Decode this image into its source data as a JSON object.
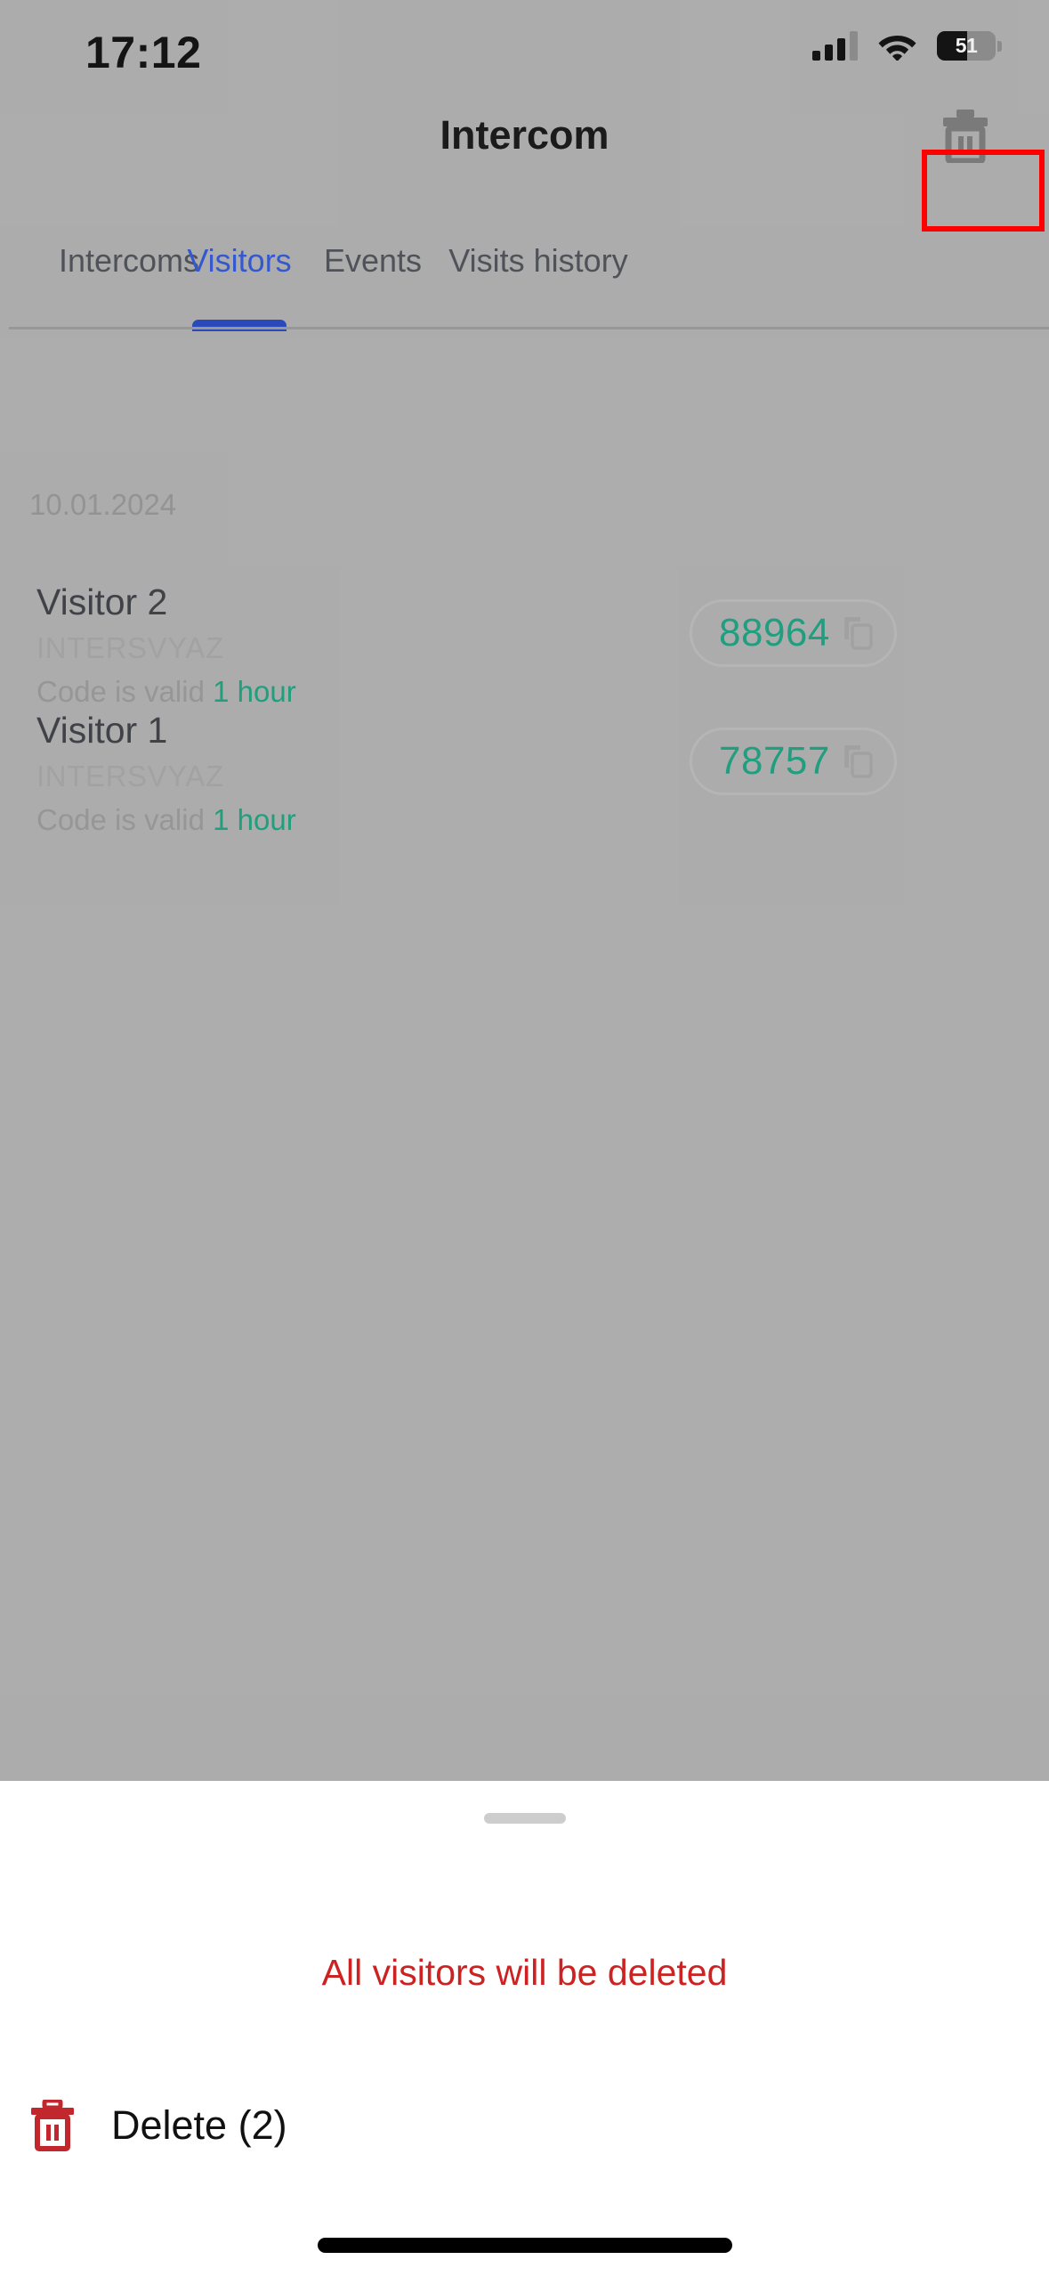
{
  "status_bar": {
    "time": "17:12",
    "battery_level": "51",
    "signal_icon": "cellular-signal-icon",
    "wifi_icon": "wifi-icon",
    "battery_icon": "battery-icon"
  },
  "header": {
    "title": "Intercom",
    "delete_all_icon": "trash-icon",
    "highlight_color": "#ff0000"
  },
  "tabs": {
    "active_color": "#2d55d8",
    "items": [
      {
        "label": "Intercoms",
        "active": false
      },
      {
        "label": "Visitors",
        "active": true
      },
      {
        "label": "Events",
        "active": false
      },
      {
        "label": "Visits history",
        "active": false
      }
    ]
  },
  "list": {
    "date_header": "10.01.2024",
    "code_color": "#18a382",
    "visitors": [
      {
        "name": "Visitor 2",
        "org": "INTERSVYAZ",
        "validity_prefix": "Code is valid ",
        "validity_value": "1 hour",
        "code": "88964",
        "copy_icon": "copy-icon"
      },
      {
        "name": "Visitor 1",
        "org": "INTERSVYAZ",
        "validity_prefix": "Code is valid ",
        "validity_value": "1 hour",
        "code": "78757",
        "copy_icon": "copy-icon"
      }
    ]
  },
  "bottom_sheet": {
    "handle": "drag-handle",
    "warning": "All visitors will be deleted",
    "warning_color": "#cc2222",
    "delete_label": "Delete (2)",
    "delete_icon": "trash-icon"
  }
}
